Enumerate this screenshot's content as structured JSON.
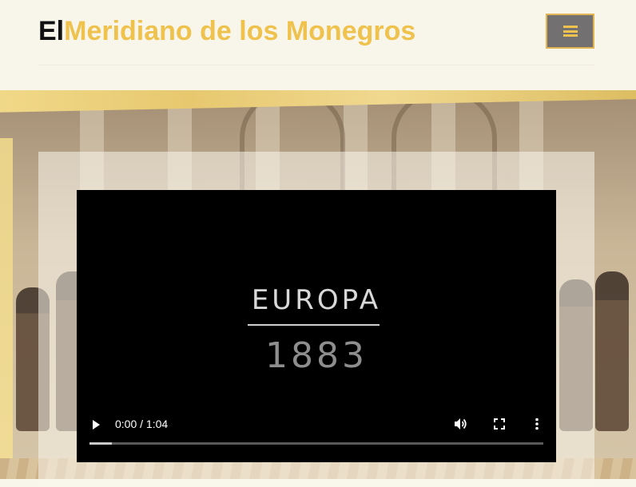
{
  "header": {
    "site_title_first": "El",
    "site_title_rest": "Meridiano de los Monegros",
    "menu_icon": "hamburger-menu-icon",
    "colors": {
      "title_accent": "#efc14d",
      "menu_bg": "#727070",
      "menu_border": "#e3b551"
    }
  },
  "video": {
    "overlay_title": "EUROPA",
    "overlay_year": "1883",
    "time_display": "0:00 / 1:04",
    "progress_fraction": 0.05,
    "controls": {
      "play_icon": "play-icon",
      "volume_icon": "volume-icon",
      "fullscreen_icon": "fullscreen-icon",
      "more_icon": "more-options-icon"
    }
  }
}
